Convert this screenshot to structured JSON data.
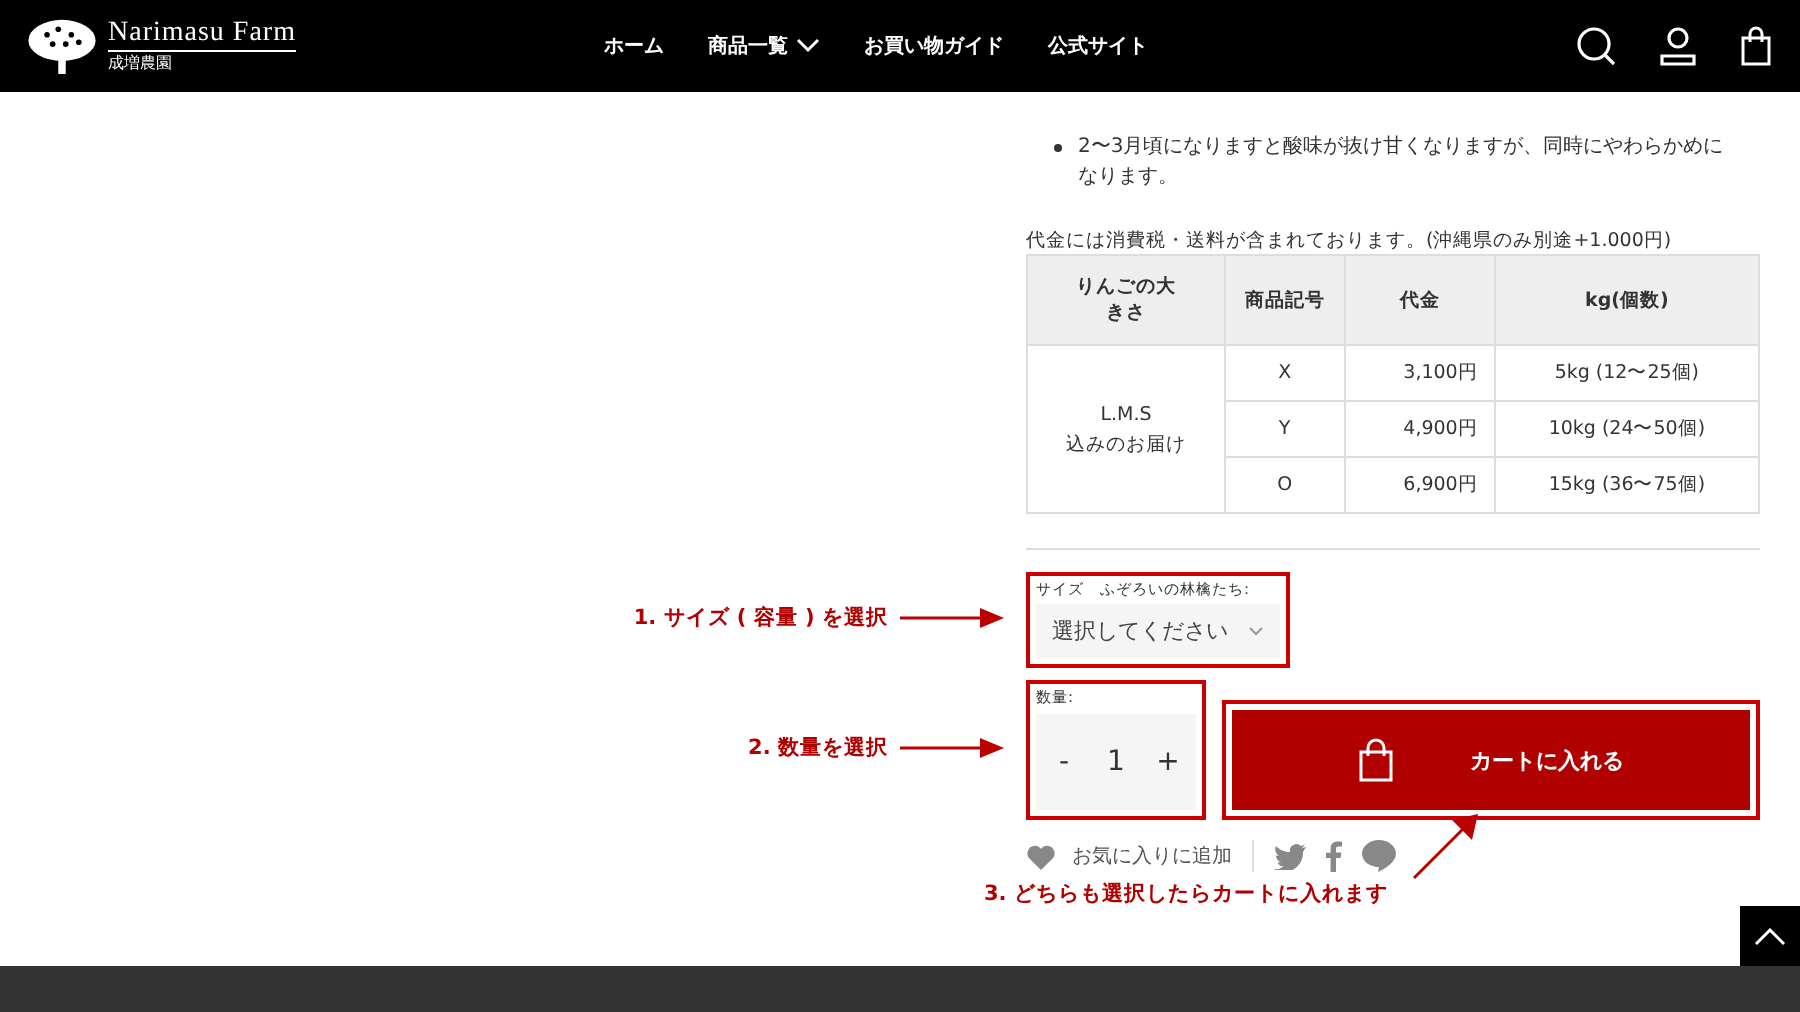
{
  "header": {
    "logo": {
      "name": "Narimasu Farm",
      "subtitle": "成増農園"
    },
    "nav": [
      {
        "label": "ホーム",
        "dropdown": false
      },
      {
        "label": "商品一覧",
        "dropdown": true
      },
      {
        "label": "お買い物ガイド",
        "dropdown": false
      },
      {
        "label": "公式サイト",
        "dropdown": false
      }
    ]
  },
  "notes": [
    "2〜3月頃になりますと酸味が抜け甘くなりますが、同時にやわらかめになります。"
  ],
  "price_note": "代金には消費税・送料が含まれております。(沖縄県のみ別途+1.000円)",
  "table": {
    "columns": [
      "りんごの大きさ",
      "商品記号",
      "代金",
      "kg(個数)"
    ],
    "group_label": "L.M.S\n込みのお届け",
    "rows": [
      {
        "code": "X",
        "price": "3,100円",
        "weight": "5kg (12〜25個)"
      },
      {
        "code": "Y",
        "price": "4,900円",
        "weight": "10kg (24〜50個)"
      },
      {
        "code": "O",
        "price": "6,900円",
        "weight": "15kg (36〜75個)"
      }
    ]
  },
  "size_select": {
    "label": "サイズ　ふぞろいの林檎たち:",
    "placeholder": "選択してください"
  },
  "quantity": {
    "label": "数量:",
    "minus": "-",
    "value": "1",
    "plus": "+"
  },
  "cart_button": "カートに入れる",
  "favorite": "お気に入りに追加",
  "annotations": [
    "1. サイズ ( 容量 ) を選択",
    "2. 数量を選択",
    "3. どちらも選択したらカートに入れます"
  ]
}
